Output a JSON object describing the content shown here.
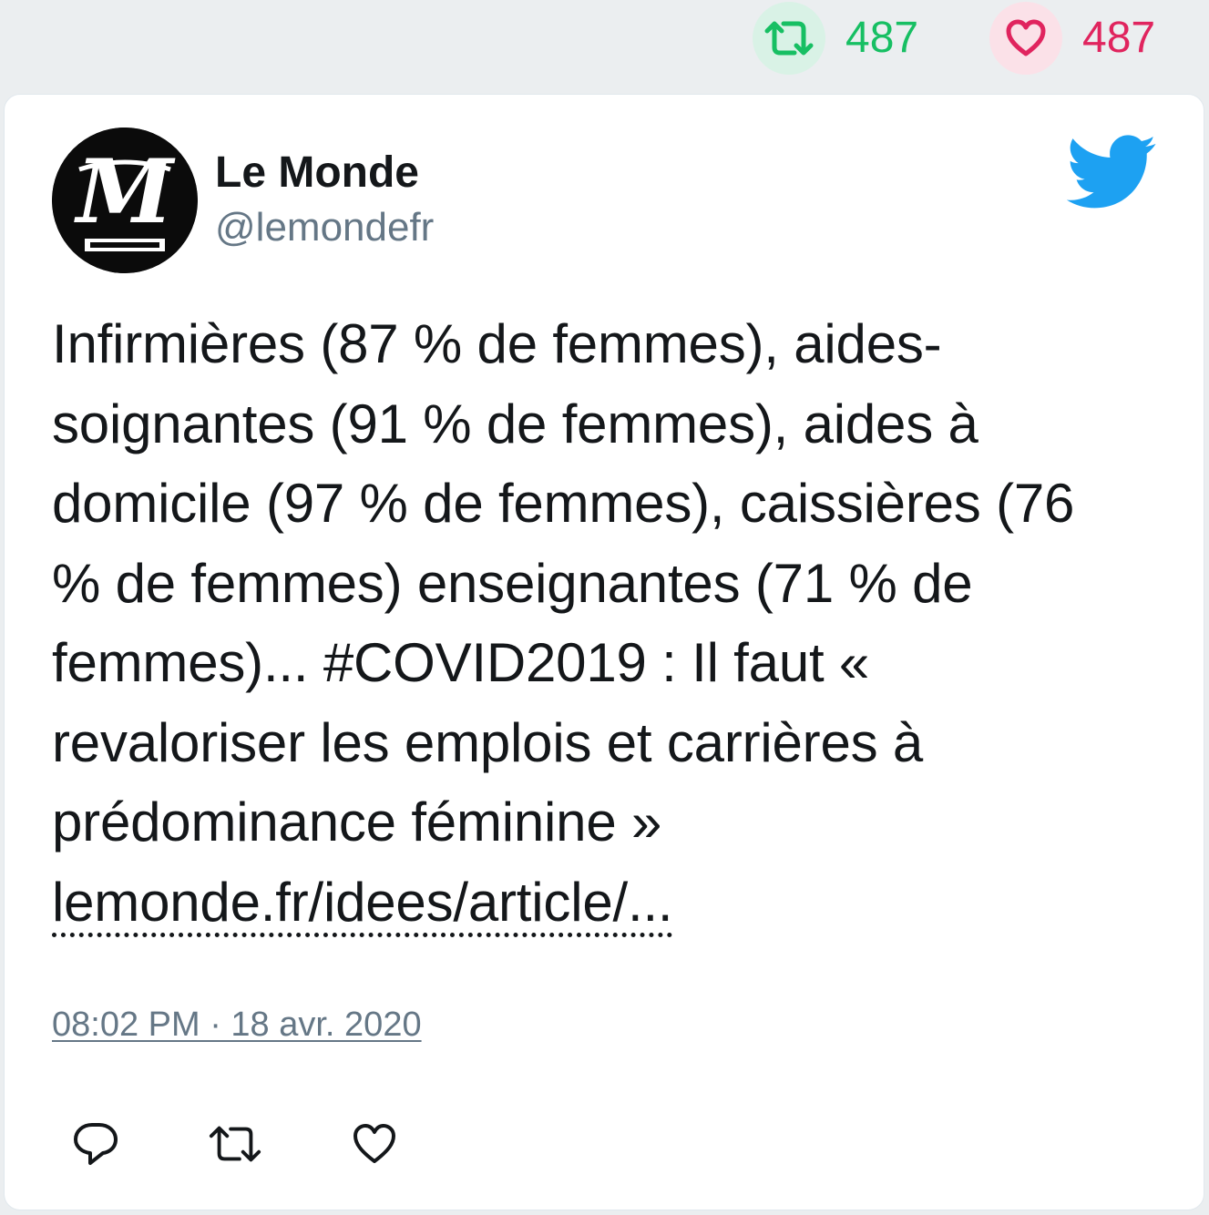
{
  "stats": {
    "retweets": {
      "count": "487",
      "icon": "retweet-icon",
      "color": "#17bf63"
    },
    "likes": {
      "count": "487",
      "icon": "heart-icon",
      "color": "#e0245e"
    }
  },
  "tweet": {
    "author": {
      "name": "Le Monde",
      "handle": "@lemondefr",
      "avatar_icon": "le-monde-logo"
    },
    "platform_icon": "twitter-bird-icon",
    "text": "Infirmières (87 % de femmes), aides-soignantes (91 % de femmes), aides à domicile (97 % de femmes), caissières (76 % de femmes) enseignantes (71 % de femmes)... #COVID2019 : Il faut « revaloriser les emplois et carrières à prédominance féminine »",
    "link": "lemonde.fr/idees/article/...",
    "timestamp": "08:02 PM · 18 avr. 2020"
  },
  "actions": [
    {
      "icon": "reply-icon"
    },
    {
      "icon": "retweet-icon"
    },
    {
      "icon": "like-icon"
    }
  ]
}
